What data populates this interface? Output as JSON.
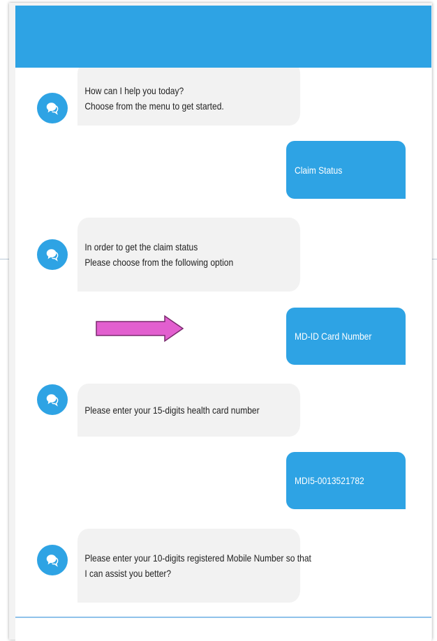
{
  "colors": {
    "accent": "#2ea3e4",
    "bot_bubble": "#f2f2f2",
    "arrow": "#e25fcf"
  },
  "icons": {
    "avatar": "chat-bubbles-icon",
    "arrow": "right-arrow-icon"
  },
  "messages": {
    "bot_1": {
      "line_1": "How can I help you today?",
      "line_2": "Choose from the menu to get started."
    },
    "user_1": "Claim Status",
    "bot_2": {
      "line_1": "In order to get the claim status",
      "line_2": "Please choose from the following option"
    },
    "user_2": "MD-ID Card Number",
    "bot_3": {
      "line_1": "Please enter your 15-digits health card number"
    },
    "user_3": "MDI5-0013521782",
    "bot_4": {
      "line_1": "Please enter your 10-digits registered Mobile Number so that",
      "line_2": "I can assist you better?"
    }
  }
}
